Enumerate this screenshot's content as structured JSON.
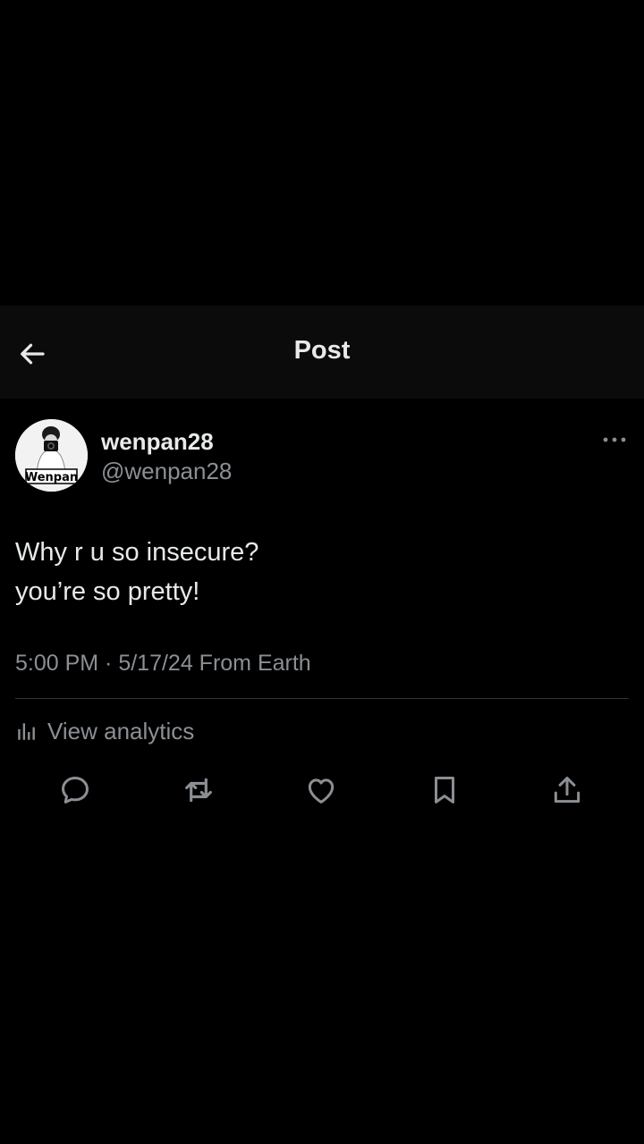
{
  "header": {
    "title": "Post",
    "back_icon": "arrow-left-icon"
  },
  "post": {
    "avatar_label": "Wenpan",
    "display_name": "wenpan28",
    "handle": "@wenpan28",
    "more_icon": "more-horizontal-icon",
    "text_lines": [
      "Why r u so insecure?",
      "you’re so pretty!"
    ],
    "meta": "5:00 PM · 5/17/24 From Earth",
    "analytics_label": "View analytics",
    "analytics_icon": "bar-chart-icon"
  },
  "actions": [
    {
      "name": "reply",
      "icon": "reply-icon"
    },
    {
      "name": "repost",
      "icon": "repost-icon"
    },
    {
      "name": "like",
      "icon": "heart-icon"
    },
    {
      "name": "bookmark",
      "icon": "bookmark-icon"
    },
    {
      "name": "share",
      "icon": "share-icon"
    }
  ],
  "colors": {
    "background": "#000000",
    "header_background": "#0b0b0b",
    "primary_text": "#e7e9ea",
    "secondary_text": "#8b8f94",
    "divider": "#2f3336"
  }
}
